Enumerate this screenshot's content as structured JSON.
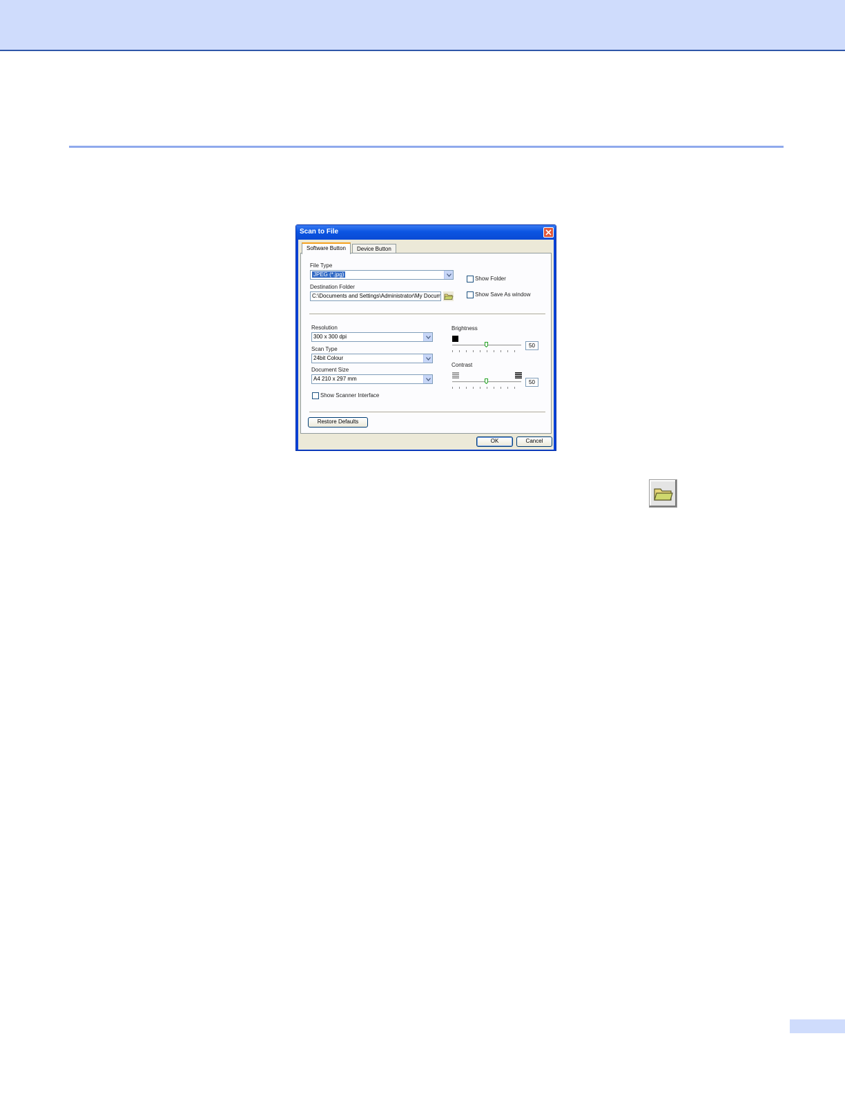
{
  "dialog": {
    "title": "Scan to File",
    "tabs": [
      {
        "label": "Software Button",
        "active": true
      },
      {
        "label": "Device Button",
        "active": false
      }
    ],
    "file_type": {
      "label": "File Type",
      "value": "JPEG (*.jpg)"
    },
    "destination_folder": {
      "label": "Destination Folder",
      "value": "C:\\Documents and Settings\\Administrator\\My Docume"
    },
    "show_folder": {
      "label": "Show Folder",
      "checked": false
    },
    "show_save_as": {
      "label": "Show Save As window",
      "checked": false
    },
    "resolution": {
      "label": "Resolution",
      "value": "300 x 300 dpi"
    },
    "scan_type": {
      "label": "Scan Type",
      "value": "24bit Colour"
    },
    "document_size": {
      "label": "Document Size",
      "value": "A4 210 x 297 mm"
    },
    "show_scanner_interface": {
      "label": "Show Scanner Interface",
      "checked": false
    },
    "brightness": {
      "label": "Brightness",
      "value": "50"
    },
    "contrast": {
      "label": "Contrast",
      "value": "50"
    },
    "restore_defaults": "Restore Defaults",
    "ok": "OK",
    "cancel": "Cancel"
  },
  "icons": {
    "close": "close-icon",
    "folder": "folder-icon",
    "dropdown": "chevron-down-icon"
  },
  "colors": {
    "title_bar": "#0b55e2",
    "dialog_face": "#ece9d8",
    "page_band": "#cfdcfc",
    "page_rule": "#8fa9ec",
    "selection": "#316ac5"
  }
}
